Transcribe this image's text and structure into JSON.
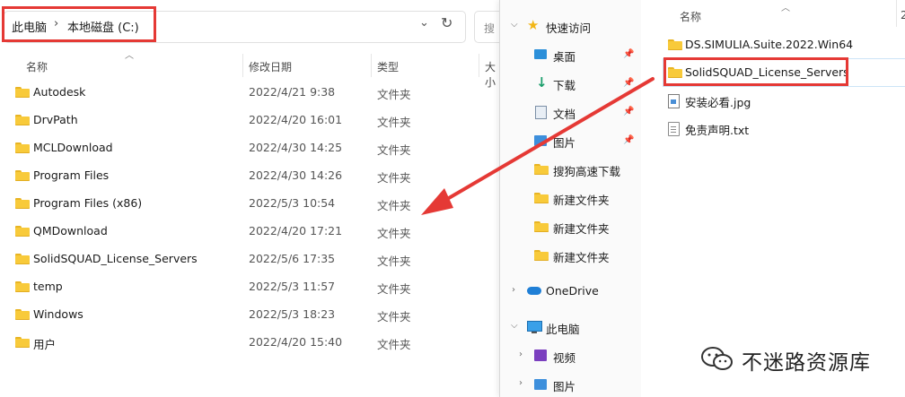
{
  "left": {
    "breadcrumb": [
      "此电脑",
      "本地磁盘 (C:)"
    ],
    "search_placeholder": "搜",
    "columns": {
      "name": "名称",
      "date": "修改日期",
      "type": "类型",
      "size": "大小"
    },
    "rows": [
      {
        "name": "Autodesk",
        "date": "2022/4/21 9:38",
        "type": "文件夹"
      },
      {
        "name": "DrvPath",
        "date": "2022/4/20 16:01",
        "type": "文件夹"
      },
      {
        "name": "MCLDownload",
        "date": "2022/4/30 14:25",
        "type": "文件夹"
      },
      {
        "name": "Program Files",
        "date": "2022/4/30 14:26",
        "type": "文件夹"
      },
      {
        "name": "Program Files (x86)",
        "date": "2022/5/3 10:54",
        "type": "文件夹"
      },
      {
        "name": "QMDownload",
        "date": "2022/4/20 17:21",
        "type": "文件夹"
      },
      {
        "name": "SolidSQUAD_License_Servers",
        "date": "2022/5/6 17:35",
        "type": "文件夹"
      },
      {
        "name": "temp",
        "date": "2022/5/3 11:57",
        "type": "文件夹"
      },
      {
        "name": "Windows",
        "date": "2022/5/3 18:23",
        "type": "文件夹"
      },
      {
        "name": "用户",
        "date": "2022/4/20 15:40",
        "type": "文件夹"
      }
    ]
  },
  "right": {
    "nav": [
      {
        "label": "快速访问",
        "icon": "star-icon"
      },
      {
        "label": "桌面",
        "icon": "desktop-icon",
        "pinned": true
      },
      {
        "label": "下载",
        "icon": "download-icon",
        "pinned": true
      },
      {
        "label": "文档",
        "icon": "document-icon",
        "pinned": true
      },
      {
        "label": "图片",
        "icon": "pictures-icon",
        "pinned": true
      },
      {
        "label": "搜狗高速下载",
        "icon": "folder-icon"
      },
      {
        "label": "新建文件夹",
        "icon": "folder-icon"
      },
      {
        "label": "新建文件夹",
        "icon": "folder-icon"
      },
      {
        "label": "新建文件夹",
        "icon": "folder-icon"
      },
      {
        "label": "OneDrive",
        "icon": "cloud-icon"
      },
      {
        "label": "此电脑",
        "icon": "computer-icon"
      },
      {
        "label": "视频",
        "icon": "video-icon"
      },
      {
        "label": "图片",
        "icon": "pictures-icon"
      }
    ],
    "column_name": "名称",
    "column_date_partial": "2",
    "files": [
      {
        "name": "DS.SIMULIA.Suite.2022.Win64",
        "kind": "folder"
      },
      {
        "name": "SolidSQUAD_License_Servers",
        "kind": "folder"
      },
      {
        "name": "安装必看.jpg",
        "kind": "image"
      },
      {
        "name": "免责声明.txt",
        "kind": "text"
      }
    ]
  },
  "watermark": {
    "text": "不迷路资源库",
    "icon": "wechat-icon"
  },
  "colors": {
    "highlight_red": "#e53935",
    "arrow_red": "#e53935",
    "folder_yellow": "#f8ca3a",
    "selection_blue": "#cce4f7"
  }
}
